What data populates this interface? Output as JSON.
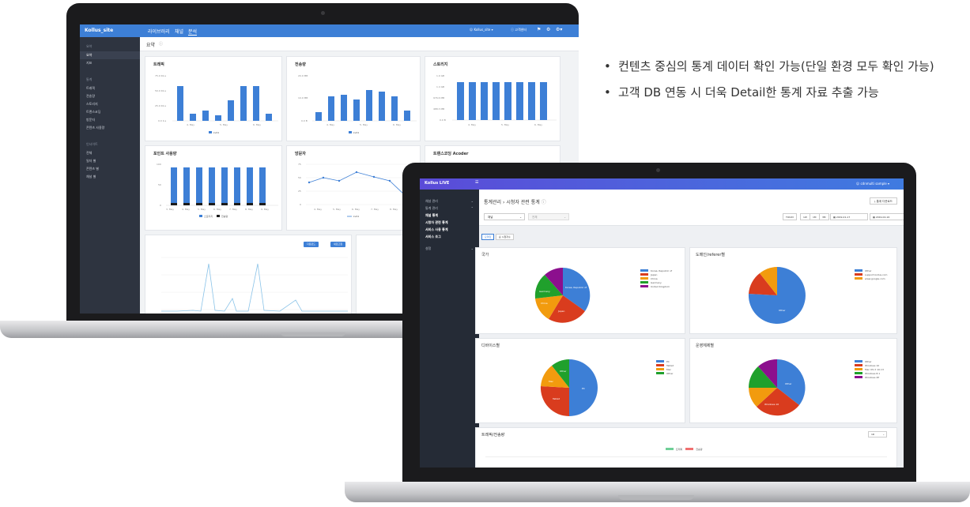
{
  "bullets": [
    "컨텐츠 중심의 통계 데이터 확인 가능(단일 환경 모두 확인 가능)",
    "고객 DB 연동 시 더욱 Detail한 통계 자료 추출 가능"
  ],
  "laptop1": {
    "app_name": "Kollus_site",
    "nav": [
      "라이브러리",
      "채널",
      "분석"
    ],
    "user": "Kollus_site",
    "help": "고객센터",
    "page_title": "요약",
    "sidebar": [
      {
        "section": "요약",
        "items": [
          "요약",
          "지표"
        ]
      },
      {
        "section": "통계",
        "items": [
          "트래픽",
          "전송량",
          "스토리지",
          "트랜스코딩",
          "방문자",
          "콘텐츠 사용량"
        ]
      },
      {
        "section": "인사이트",
        "items": [
          "전체",
          "일자 별",
          "콘텐츠 별",
          "채널 별"
        ]
      }
    ],
    "cards": {
      "traffic": {
        "title": "트래픽",
        "yticks": [
          "75.0 Kb.s",
          "50.0 Kb.s",
          "25.0 Kb.s",
          "0.0 b.s"
        ],
        "xticks": [
          "4. May",
          "5. May",
          "6. May"
        ],
        "legend": "kv01"
      },
      "transfer": {
        "title": "전송량",
        "yticks": [
          "20.0 MB",
          "10.0 MB",
          "0.0 B"
        ],
        "xticks": [
          "4. May",
          "5. May",
          "6. May"
        ],
        "legend": "kv01"
      },
      "storage": {
        "title": "스토리지",
        "yticks": [
          "1.9 GB",
          "1.4 GB",
          "976.6 MB",
          "488.3 MB",
          "0.0 B"
        ],
        "xticks": [
          "4. May",
          "5. May",
          "6. May"
        ]
      },
      "point": {
        "title": "포인트 사용량",
        "yticks": [
          "100",
          "50",
          "0"
        ],
        "xticks": [
          "3. May",
          "4. May",
          "5. May",
          "6. May",
          "7. May",
          "8. May",
          "9. May"
        ],
        "legend": [
          "스토리지",
          "전송량"
        ]
      },
      "visitors": {
        "title": "방문자",
        "yticks": [
          "75",
          "50",
          "25",
          "0"
        ],
        "xticks": [
          "4. May",
          "5. May",
          "6. May",
          "7. May",
          "8. May"
        ],
        "legend": "kv01"
      },
      "transcoding": {
        "title": "트랜스코딩 Acoder"
      }
    },
    "buttons": [
      "다운로드",
      "새로고침"
    ]
  },
  "laptop2": {
    "app_name": "Kollus LIVE",
    "user": "cdnmulti sample",
    "breadcrumb": [
      "통계관리",
      "시청자 관련 통계"
    ],
    "export": "통계 다운로드",
    "sidebar": [
      "채널 관리",
      "통계 관리",
      "채널 통계",
      "시청자 관련 통계",
      "서비스 사용 통계",
      "서비스 조그",
      "설정"
    ],
    "filters": {
      "channel": "채널",
      "sub": "전체"
    },
    "date_buttons": [
      "TODAY",
      "1W",
      "1M",
      "3M"
    ],
    "date_from": "2019-01-17",
    "date_to": "2019-02-16",
    "tabs": [
      "요약값",
      "순 시청자수"
    ],
    "panels": {
      "country": {
        "title": "국가",
        "legend": [
          "Korea, Republic of",
          "Japan",
          "China",
          "Germany",
          "United Kingdom"
        ]
      },
      "domain": {
        "title": "도메인/referer별",
        "legend": [
          "Other",
          "support.kollus.com",
          "www.google.com"
        ]
      },
      "device": {
        "title": "디바이스별",
        "legend": [
          "PC",
          "Tablet",
          "Mac",
          "Other"
        ]
      },
      "os": {
        "title": "운영체제별",
        "legend": [
          "Other",
          "Windows 10",
          "Mac OS X 10.13",
          "Windows 8.1",
          "Windows XP"
        ]
      },
      "traffic": {
        "title": "트래픽/전송량",
        "period": "1D",
        "legend": [
          "트래픽",
          "전송량"
        ]
      }
    }
  },
  "colors": {
    "blue": "#3d7fd6",
    "red": "#d93c1e",
    "orange": "#f29b0e",
    "green": "#20a02c",
    "purple": "#8c0f8e",
    "sidebar": "#2e3440"
  }
}
